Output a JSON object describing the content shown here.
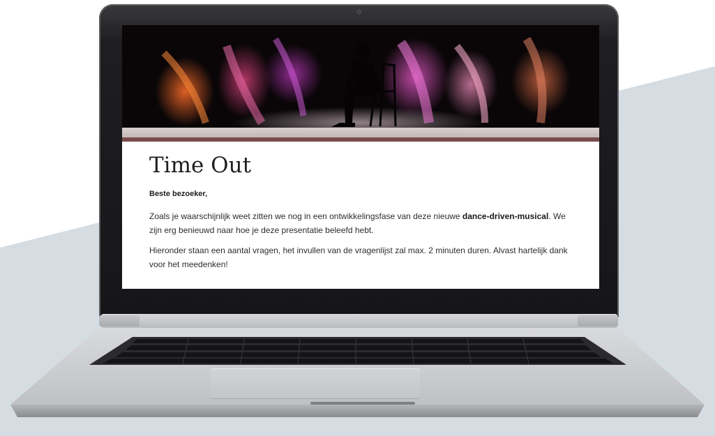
{
  "form": {
    "title": "Time Out",
    "greeting": "Beste bezoeker,",
    "intro_before_bold": "Zoals je waarschijnlijk weet zitten we nog in een ontwikkelingsfase van deze nieuwe",
    "intro_bold": "dance-driven-musical",
    "intro_after_bold": ". We zijn erg benieuwd naar hoe je deze presentatie beleefd hebt.",
    "instructions": "Hieronder staan een aantal vragen, het invullen van de vragenlijst zal max. 2 minuten duren. Alvast hartelijk dank voor het meedenken!"
  },
  "colors": {
    "background_panel": "#d5dde3",
    "banner_band_light": "#c4b8b8",
    "banner_band_dark": "#7a4b4b",
    "laptop_bezel": "#161618",
    "laptop_body": "#c9cacd"
  },
  "icons": {
    "hero_image": "dancers-with-seated-silhouette"
  }
}
